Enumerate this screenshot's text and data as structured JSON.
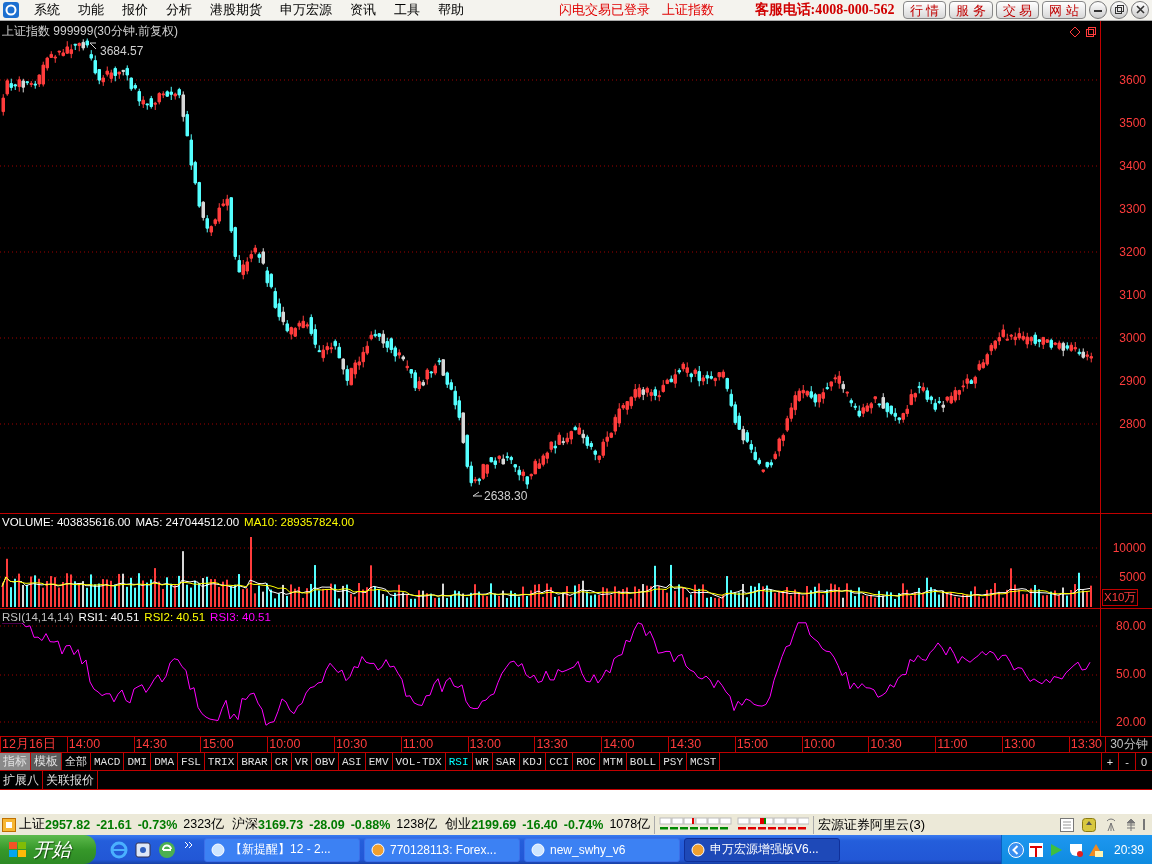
{
  "menu": {
    "items": [
      "系统",
      "功能",
      "报价",
      "分析",
      "港股期货",
      "申万宏源",
      "资讯",
      "工具",
      "帮助"
    ],
    "status_links": [
      "闪电交易已登录",
      "上证指数"
    ],
    "hotline": "客服电话:4008-000-562",
    "nav_buttons": [
      "行 情",
      "服 务",
      "交 易",
      "网 站"
    ]
  },
  "price_chart": {
    "title": "上证指数 999999(30分钟.前复权)",
    "high_label": "3684.57",
    "low_label": "2638.30",
    "y_ticks": [
      "3600",
      "3500",
      "3400",
      "3300",
      "3200",
      "3100",
      "3000",
      "2900",
      "2800"
    ]
  },
  "volume_chart": {
    "legend": [
      {
        "text": "VOLUME: 403835616.00",
        "color": "#ffffff"
      },
      {
        "text": "MA5: 247044512.00",
        "color": "#ffffff"
      },
      {
        "text": "MA10: 289357824.00",
        "color": "#ffff00"
      }
    ],
    "y_ticks": [
      "10000",
      "5000"
    ],
    "unit": "X10万"
  },
  "rsi_chart": {
    "legend": [
      {
        "text": "RSI(14,14,14)",
        "color": "#c0c0c0"
      },
      {
        "text": "RSI1: 40.51",
        "color": "#ffffff"
      },
      {
        "text": "RSI2: 40.51",
        "color": "#ffff00"
      },
      {
        "text": "RSI3: 40.51",
        "color": "#ff00ff"
      }
    ],
    "y_ticks": [
      "80.00",
      "50.00",
      "20.00"
    ]
  },
  "time_axis": {
    "labels": [
      "12月16日",
      "14:00",
      "14:30",
      "15:00",
      "10:00",
      "10:30",
      "11:00",
      "13:00",
      "13:30",
      "14:00",
      "14:30",
      "15:00",
      "10:00",
      "10:30",
      "11:00",
      "13:00",
      "13:30"
    ],
    "period": "30分钟"
  },
  "indicator_tabs": [
    {
      "label": "指标",
      "kind": "mode",
      "selected": true
    },
    {
      "label": "模板",
      "kind": "mode",
      "selected": false
    },
    {
      "label": "全部",
      "kind": "indicator",
      "selected": false
    },
    {
      "label": "MACD",
      "kind": "indicator",
      "selected": false
    },
    {
      "label": "DMI",
      "kind": "indicator",
      "selected": false
    },
    {
      "label": "DMA",
      "kind": "indicator",
      "selected": false
    },
    {
      "label": "FSL",
      "kind": "indicator",
      "selected": false
    },
    {
      "label": "TRIX",
      "kind": "indicator",
      "selected": false
    },
    {
      "label": "BRAR",
      "kind": "indicator",
      "selected": false
    },
    {
      "label": "CR",
      "kind": "indicator",
      "selected": false
    },
    {
      "label": "VR",
      "kind": "indicator",
      "selected": false
    },
    {
      "label": "OBV",
      "kind": "indicator",
      "selected": false
    },
    {
      "label": "ASI",
      "kind": "indicator",
      "selected": false
    },
    {
      "label": "EMV",
      "kind": "indicator",
      "selected": false
    },
    {
      "label": "VOL-TDX",
      "kind": "indicator",
      "selected": false
    },
    {
      "label": "RSI",
      "kind": "indicator",
      "selected": true
    },
    {
      "label": "WR",
      "kind": "indicator",
      "selected": false
    },
    {
      "label": "SAR",
      "kind": "indicator",
      "selected": false
    },
    {
      "label": "KDJ",
      "kind": "indicator",
      "selected": false
    },
    {
      "label": "CCI",
      "kind": "indicator",
      "selected": false
    },
    {
      "label": "ROC",
      "kind": "indicator",
      "selected": false
    },
    {
      "label": "MTM",
      "kind": "indicator",
      "selected": false
    },
    {
      "label": "BOLL",
      "kind": "indicator",
      "selected": false
    },
    {
      "label": "PSY",
      "kind": "indicator",
      "selected": false
    },
    {
      "label": "MCST",
      "kind": "indicator",
      "selected": false
    }
  ],
  "zoom_buttons": [
    "+",
    "-",
    "0"
  ],
  "sub_tabs": [
    "扩展八",
    "关联报价"
  ],
  "market_bar": {
    "indices": [
      {
        "name": "上证",
        "price": "2957.82",
        "change": "-21.61",
        "percent": "-0.73%",
        "turnover": "2323亿"
      },
      {
        "name": "沪深",
        "price": "3169.73",
        "change": "-28.09",
        "percent": "-0.88%",
        "turnover": "1238亿"
      },
      {
        "name": "创业",
        "price": "2199.69",
        "change": "-16.40",
        "percent": "-0.74%",
        "turnover": "1078亿"
      }
    ],
    "broker": "宏源证券阿里云(3)"
  },
  "taskbar": {
    "start": "开始",
    "tasks": [
      {
        "label": "【新提醒】12 - 2...",
        "selected": false
      },
      {
        "label": "770128113: Forex...",
        "selected": false
      },
      {
        "label": "new_swhy_v6",
        "selected": false
      },
      {
        "label": "申万宏源增强版V6...",
        "selected": true
      }
    ],
    "clock": "20:39"
  }
}
